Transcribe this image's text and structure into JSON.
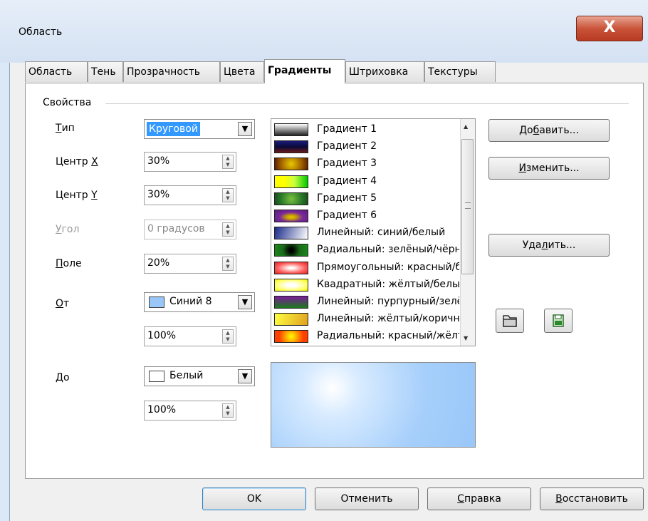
{
  "window": {
    "title": "Область",
    "close_glyph": "X"
  },
  "tabs": [
    {
      "label": "Область"
    },
    {
      "label": "Тень"
    },
    {
      "label": "Прозрачность"
    },
    {
      "label": "Цвета"
    },
    {
      "label": "Градиенты",
      "active": true
    },
    {
      "label": "Штриховка"
    },
    {
      "label": "Текстуры"
    }
  ],
  "properties": {
    "legend": "Свойства",
    "type": {
      "label_ul": "Т",
      "label_rest": "ип",
      "value": "Круговой"
    },
    "center_x": {
      "label_pre": "Центр ",
      "label_ul": "X",
      "value": "30%"
    },
    "center_y": {
      "label_pre": "Центр ",
      "label_ul": "Y",
      "value": "30%"
    },
    "angle": {
      "label_ul": "У",
      "label_rest": "гол",
      "value": "0 градусов"
    },
    "border": {
      "label_ul": "П",
      "label_rest": "оле",
      "value": "20%"
    },
    "from": {
      "label_ul": "О",
      "label_rest": "т",
      "color_name": "Синий 8",
      "color": "#99c7f8",
      "intensity": "100%"
    },
    "to": {
      "label_ul": "Д",
      "label_rest": "о",
      "color_name": "Белый",
      "color": "#ffffff",
      "intensity": "100%"
    }
  },
  "gradients": [
    {
      "name": "Градиент 1",
      "css": "linear-gradient(#ffffff, #222222)"
    },
    {
      "name": "Градиент 2",
      "css": "linear-gradient(#1a1a7a, #0a0a3a 50%, #6a1a1a)"
    },
    {
      "name": "Градиент 3",
      "css": "radial-gradient(circle at 50% 50%, #e8c800, #a06000 60%, #5a1a00)"
    },
    {
      "name": "Градиент 4",
      "css": "linear-gradient(90deg, #ffff00 30%, #c8ff40 60%, #00c800)"
    },
    {
      "name": "Градиент 5",
      "css": "radial-gradient(circle, #7ac040, #2a7a2a 60%, #1a4a1a)"
    },
    {
      "name": "Градиент 6",
      "css": "radial-gradient(ellipse at 50% 60%, #e8c800 0%, #c8a000 20%, #7a2a9a 50%, #5a1a7a)"
    },
    {
      "name": "Линейный: синий/белый",
      "css": "linear-gradient(110deg, #1a2a8a, #ffffff)"
    },
    {
      "name": "Радиальный: зелёный/чёрный",
      "css": "radial-gradient(circle, #000000 10%, #1a6a1a 50%, #1a8a1a)"
    },
    {
      "name": "Прямоугольный: красный/белый",
      "css": "radial-gradient(ellipse, #ffffff 10%, #ff6060 60%, #e02020)"
    },
    {
      "name": "Квадратный: жёлтый/белый",
      "css": "radial-gradient(ellipse, #ffffff 20%, #ffff60 70%, #f0f000)"
    },
    {
      "name": "Линейный: пурпурный/зелёный",
      "css": "linear-gradient(#7a1a9a, #1a7a1a)"
    },
    {
      "name": "Линейный: жёлтый/коричневый",
      "css": "linear-gradient(110deg, #ffff40, #e0a020)"
    },
    {
      "name": "Радиальный: красный/жёлтый",
      "css": "radial-gradient(circle, #ffff00, #ff4000 70%)"
    }
  ],
  "actions": {
    "add": {
      "pre": "До",
      "ul": "б",
      "post": "авить..."
    },
    "modify": {
      "pre": "",
      "ul": "И",
      "post": "зменить..."
    },
    "delete": {
      "pre": "Уда",
      "ul": "л",
      "post": "ить..."
    }
  },
  "footer": {
    "ok": "OK",
    "cancel": "Отменить",
    "help": {
      "ul": "С",
      "post": "правка"
    },
    "reset": {
      "ul": "В",
      "post": "осстановить"
    }
  }
}
